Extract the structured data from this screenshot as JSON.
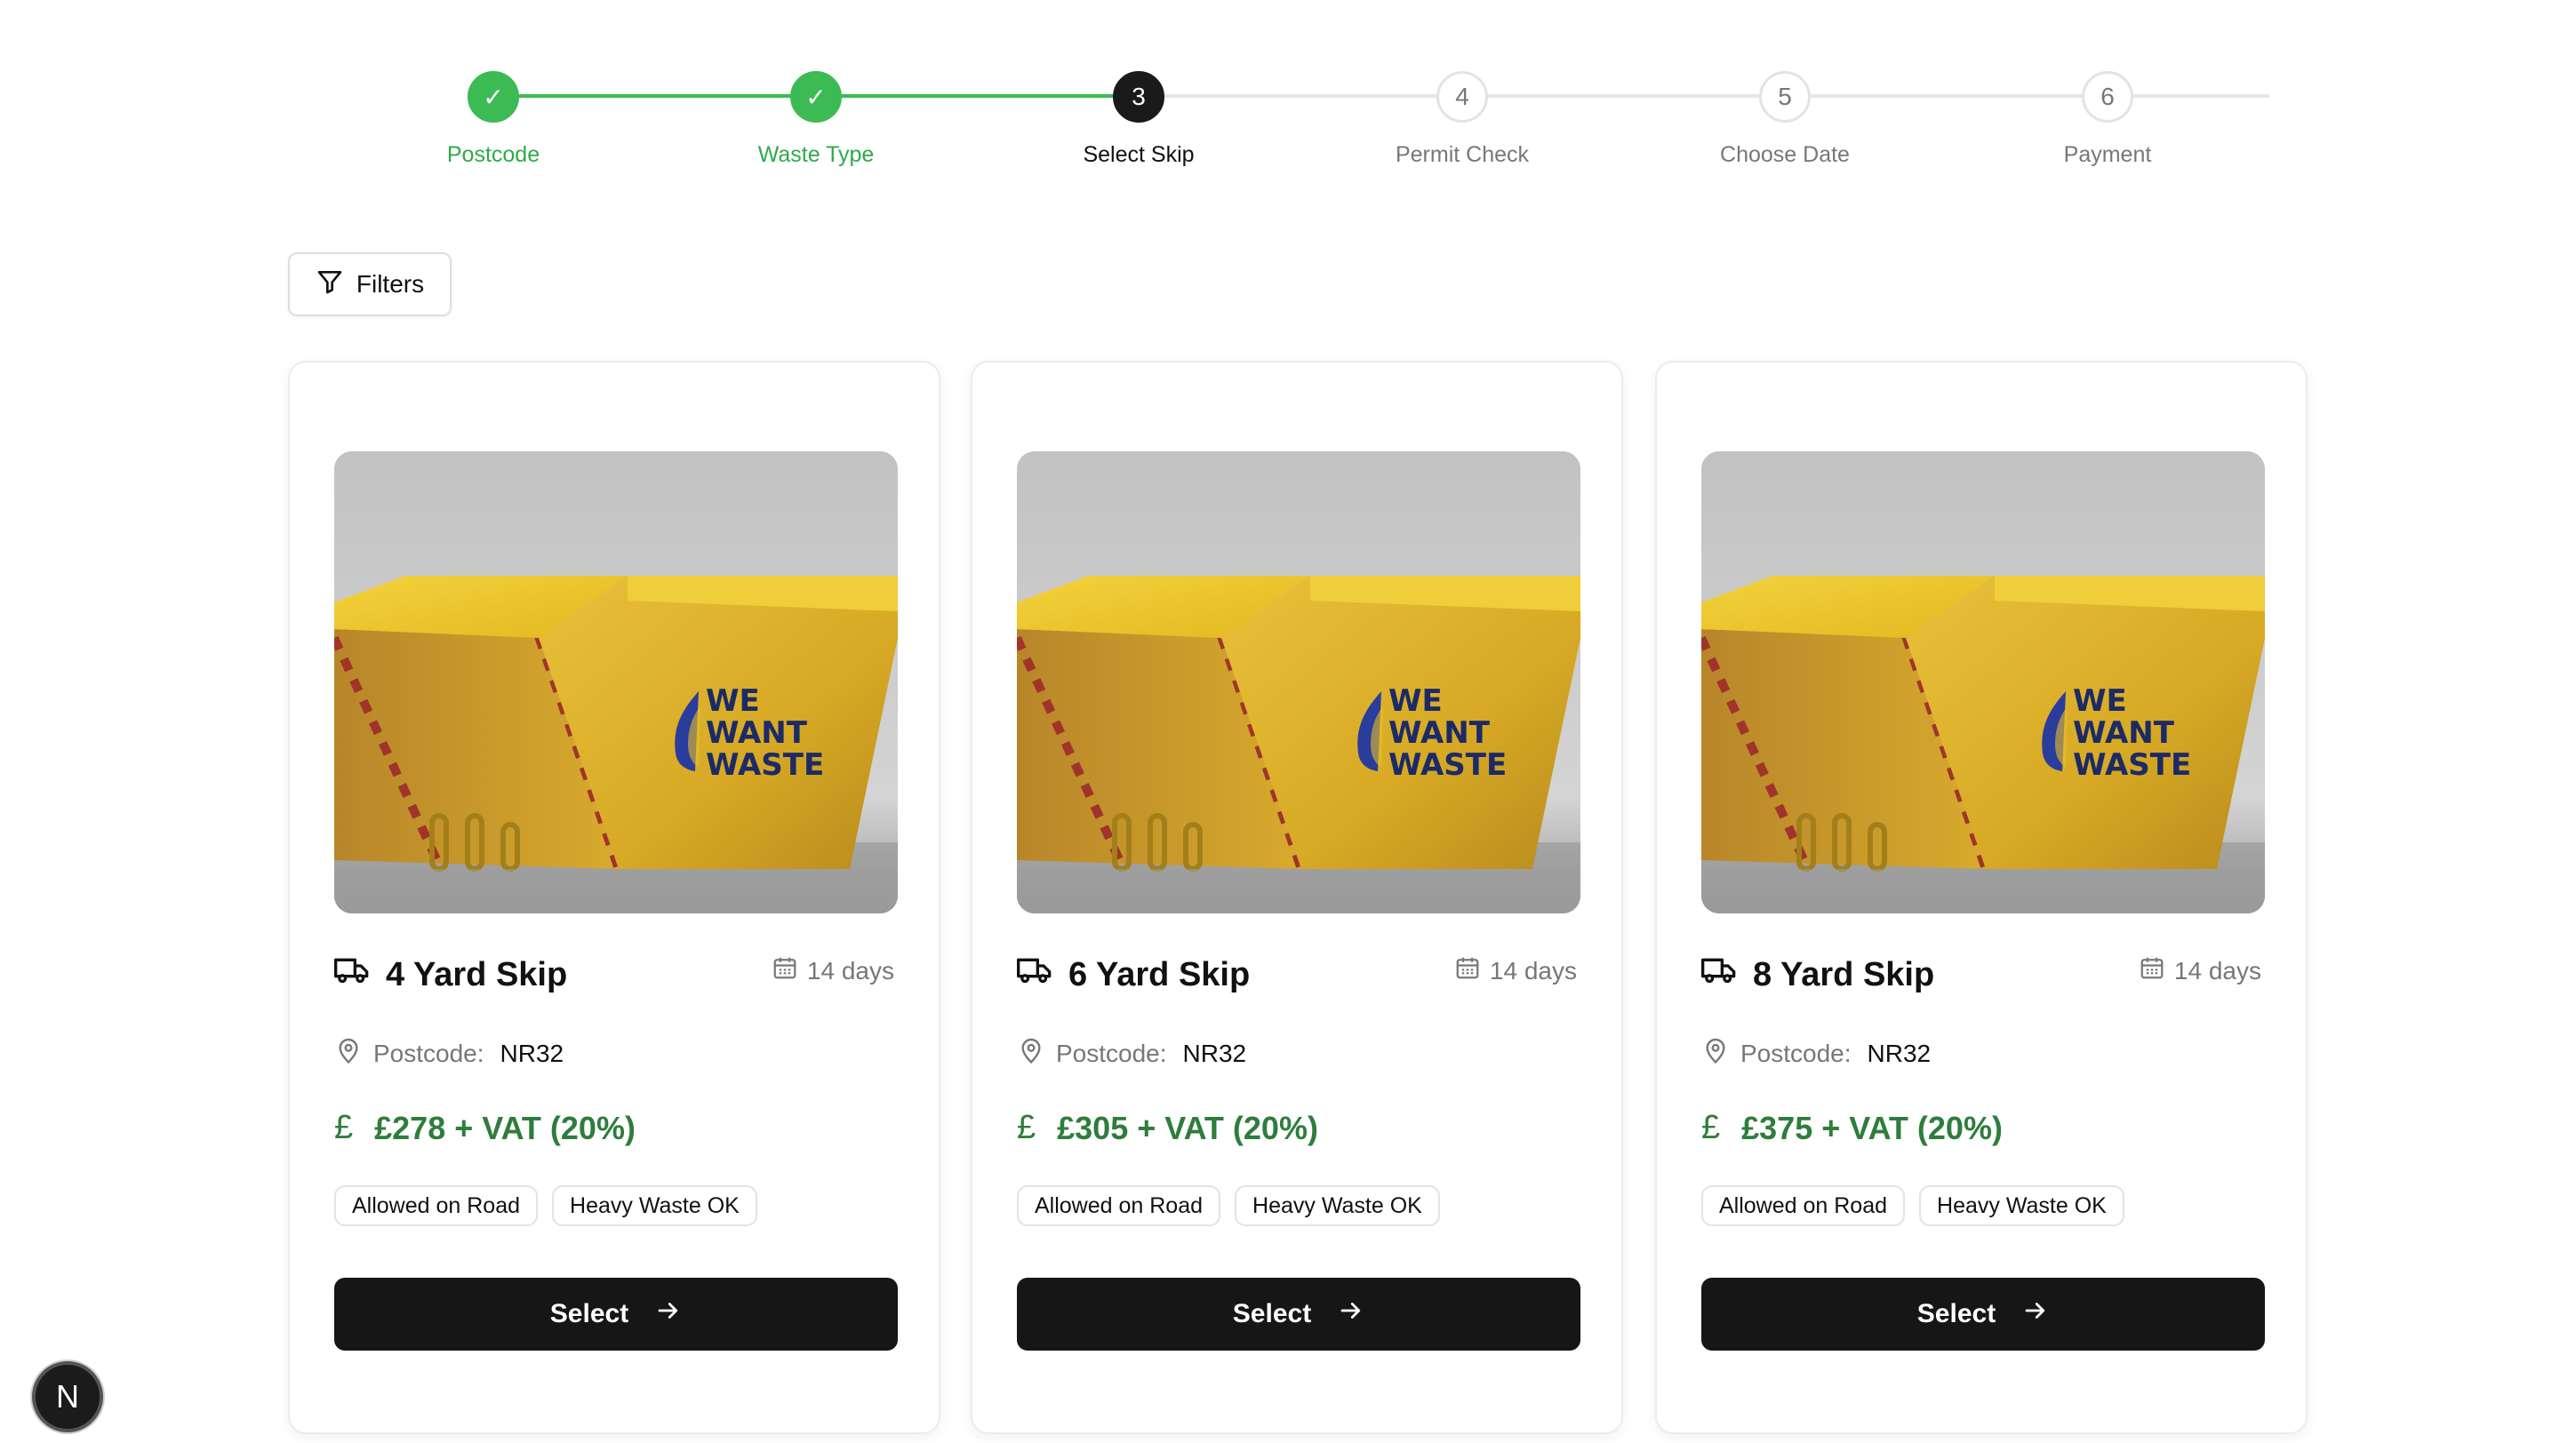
{
  "stepper": {
    "steps": [
      {
        "number": "✓",
        "label": "Postcode",
        "state": "done"
      },
      {
        "number": "✓",
        "label": "Waste Type",
        "state": "done"
      },
      {
        "number": "3",
        "label": "Select Skip",
        "state": "active"
      },
      {
        "number": "4",
        "label": "Permit Check",
        "state": "pending"
      },
      {
        "number": "5",
        "label": "Choose Date",
        "state": "pending"
      },
      {
        "number": "6",
        "label": "Payment",
        "state": "pending"
      }
    ]
  },
  "filters": {
    "label": "Filters",
    "icon": "filter-icon"
  },
  "cards": [
    {
      "title": "4 Yard Skip",
      "hire_period": "14 days",
      "postcode_label": "Postcode:",
      "postcode": "NR32",
      "currency_symbol": "£",
      "price": "£278 + VAT (20%)",
      "tags": [
        "Allowed on Road",
        "Heavy Waste OK"
      ],
      "button": "Select",
      "brand_text": [
        "WE",
        "WANT",
        "WASTE"
      ]
    },
    {
      "title": "6 Yard Skip",
      "hire_period": "14 days",
      "postcode_label": "Postcode:",
      "postcode": "NR32",
      "currency_symbol": "£",
      "price": "£305 + VAT (20%)",
      "tags": [
        "Allowed on Road",
        "Heavy Waste OK"
      ],
      "button": "Select",
      "brand_text": [
        "WE",
        "WANT",
        "WASTE"
      ]
    },
    {
      "title": "8 Yard Skip",
      "hire_period": "14 days",
      "postcode_label": "Postcode:",
      "postcode": "NR32",
      "currency_symbol": "£",
      "price": "£375 + VAT (20%)",
      "tags": [
        "Allowed on Road",
        "Heavy Waste OK"
      ],
      "button": "Select",
      "brand_text": [
        "WE",
        "WANT",
        "WASTE"
      ]
    }
  ],
  "dev_badge": {
    "label": "N"
  },
  "colors": {
    "success": "#3cba54",
    "price": "#2f7d3c",
    "primary_button": "#161616",
    "skip_yellow": "#e8bf26"
  }
}
